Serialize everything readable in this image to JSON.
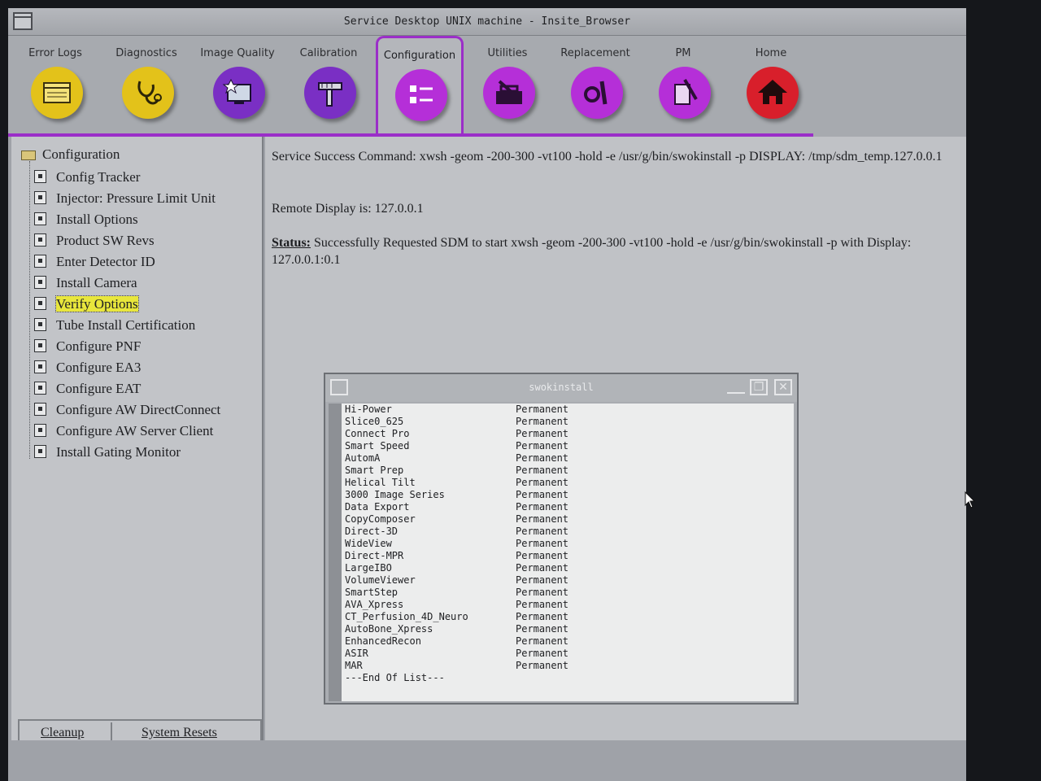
{
  "window": {
    "title": "Service Desktop UNIX machine - Insite_Browser"
  },
  "toolbar": {
    "items": [
      {
        "label": "Error Logs",
        "icon": "error-logs-icon",
        "color": "#e3c21a"
      },
      {
        "label": "Diagnostics",
        "icon": "stethoscope-icon",
        "color": "#e3c21a"
      },
      {
        "label": "Image Quality",
        "icon": "image-quality-icon",
        "color": "#7a2fc4"
      },
      {
        "label": "Calibration",
        "icon": "calibration-icon",
        "color": "#7a2fc4"
      },
      {
        "label": "Configuration",
        "icon": "checklist-icon",
        "color": "#b52fd8"
      },
      {
        "label": "Utilities",
        "icon": "toolbox-icon",
        "color": "#b52fd8"
      },
      {
        "label": "Replacement",
        "icon": "wrench-icon",
        "color": "#b52fd8"
      },
      {
        "label": "PM",
        "icon": "pm-icon",
        "color": "#b52fd8"
      },
      {
        "label": "Home",
        "icon": "home-icon",
        "color": "#d81f2b"
      }
    ],
    "active": "Configuration"
  },
  "tree": {
    "root": "Configuration",
    "items": [
      "Config Tracker",
      "Injector: Pressure Limit Unit",
      "Install Options",
      "Product SW Revs",
      "Enter Detector ID",
      "Install Camera",
      "Verify Options",
      "Tube Install Certification",
      "Configure PNF",
      "Configure EA3",
      "Configure EAT",
      "Configure AW DirectConnect",
      "Configure AW Server Client",
      "Install Gating Monitor"
    ],
    "selected": "Verify Options"
  },
  "bottom_buttons": {
    "cleanup": "Cleanup",
    "system_resets": "System Resets"
  },
  "messages": {
    "command": "Service Success Command: xwsh -geom -200-300 -vt100 -hold -e /usr/g/bin/swokinstall -p DISPLAY: /tmp/sdm_temp.127.0.0.1",
    "remote": "Remote Display is: 127.0.0.1",
    "status_label": "Status:",
    "status_text": " Successfully Requested SDM to start xwsh -geom -200-300 -vt100 -hold -e /usr/g/bin/swokinstall -p with Display: 127.0.0.1:0.1"
  },
  "subwindow": {
    "title": "swokinstall",
    "options": [
      {
        "name": "Hi-Power",
        "status": "Permanent"
      },
      {
        "name": "Slice0_625",
        "status": "Permanent"
      },
      {
        "name": "Connect Pro",
        "status": "Permanent"
      },
      {
        "name": "Smart Speed",
        "status": "Permanent"
      },
      {
        "name": "AutomA",
        "status": "Permanent"
      },
      {
        "name": "Smart Prep",
        "status": "Permanent"
      },
      {
        "name": "Helical Tilt",
        "status": "Permanent"
      },
      {
        "name": "3000 Image Series",
        "status": "Permanent"
      },
      {
        "name": "Data Export",
        "status": "Permanent"
      },
      {
        "name": "CopyComposer",
        "status": "Permanent"
      },
      {
        "name": "Direct-3D",
        "status": "Permanent"
      },
      {
        "name": "WideView",
        "status": "Permanent"
      },
      {
        "name": "Direct-MPR",
        "status": "Permanent"
      },
      {
        "name": "LargeIBO",
        "status": "Permanent"
      },
      {
        "name": "VolumeViewer",
        "status": "Permanent"
      },
      {
        "name": "SmartStep",
        "status": "Permanent"
      },
      {
        "name": "AVA_Xpress",
        "status": "Permanent"
      },
      {
        "name": "CT_Perfusion_4D_Neuro",
        "status": "Permanent"
      },
      {
        "name": "AutoBone_Xpress",
        "status": "Permanent"
      },
      {
        "name": "EnhancedRecon",
        "status": "Permanent"
      },
      {
        "name": "ASIR",
        "status": "Permanent"
      },
      {
        "name": "MAR",
        "status": "Permanent"
      }
    ],
    "end_marker": "---End Of List---"
  }
}
